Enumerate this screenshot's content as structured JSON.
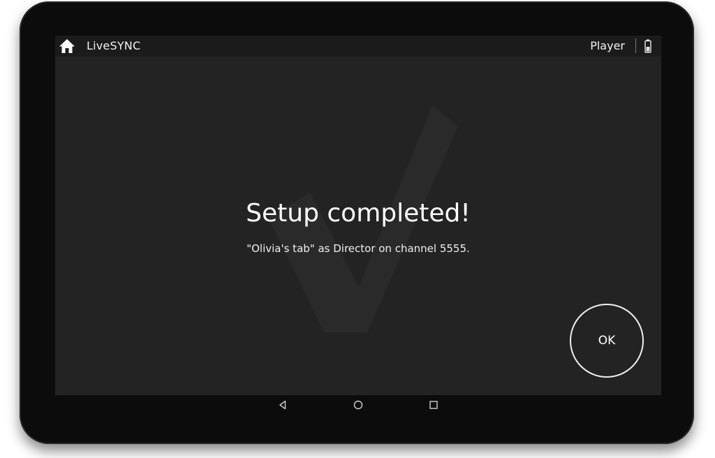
{
  "topbar": {
    "app_title": "LiveSYNC",
    "mode_label": "Player",
    "icons": [
      "home-icon",
      "battery-icon"
    ]
  },
  "dialog": {
    "title": "Setup completed!",
    "subtitle": "\"Olivia's tab\" as Director on channel 5555.",
    "ok_label": "OK",
    "watermark_icon": "checkmark-icon"
  },
  "navbar": {
    "icons": [
      "back-icon",
      "home-circle-icon",
      "recents-icon"
    ]
  },
  "colors": {
    "screen_background": "#232323",
    "topbar_background": "#1b1b1b",
    "bezel": "#0c0c0c",
    "text": "#ffffff"
  }
}
